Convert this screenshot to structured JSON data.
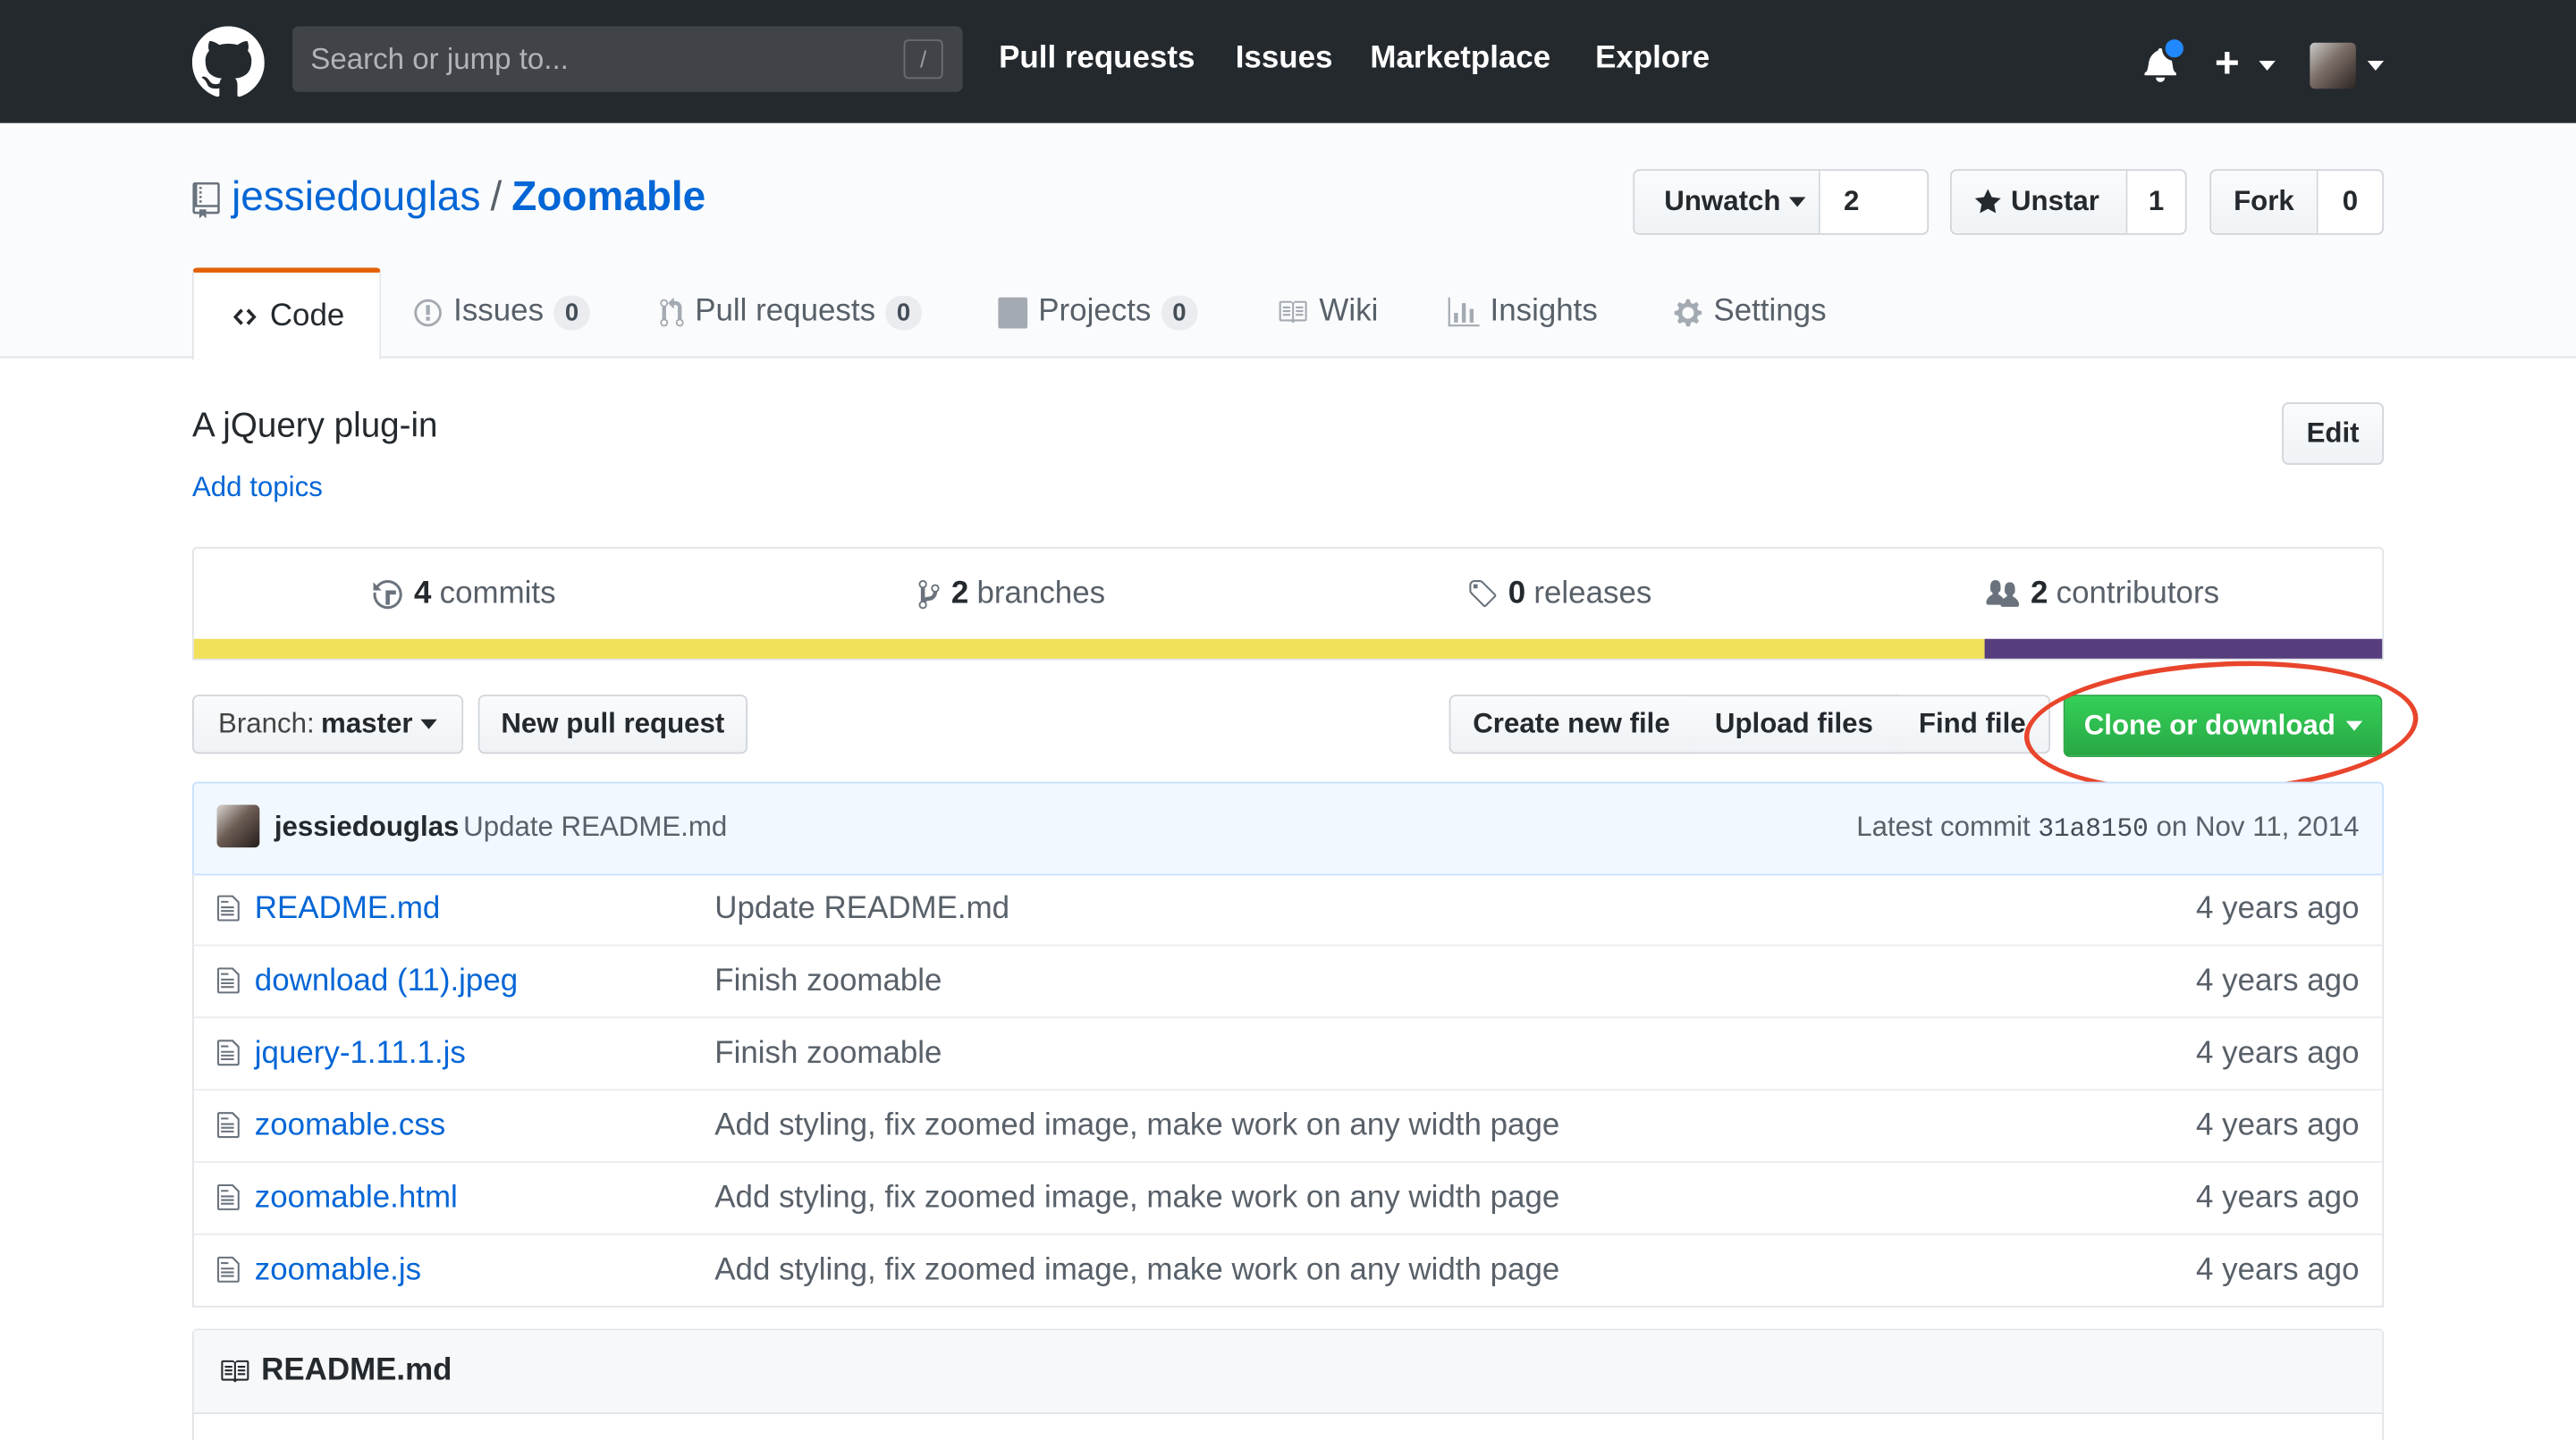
{
  "header": {
    "search_placeholder": "Search or jump to...",
    "search_shortcut": "/",
    "nav": [
      "Pull requests",
      "Issues",
      "Marketplace",
      "Explore"
    ],
    "icons": [
      "github-logo-icon",
      "bell-icon",
      "plus-icon",
      "avatar"
    ]
  },
  "repo": {
    "owner": "jessiedouglas",
    "separator": "/",
    "name": "Zoomable",
    "unwatch_label": "Unwatch",
    "watch_count": "2",
    "unstar_label": "Unstar",
    "star_count": "1",
    "fork_label": "Fork",
    "fork_count": "0"
  },
  "tabs": [
    {
      "label": "Code"
    },
    {
      "label": "Issues",
      "count": "0"
    },
    {
      "label": "Pull requests",
      "count": "0"
    },
    {
      "label": "Projects",
      "count": "0"
    },
    {
      "label": "Wiki"
    },
    {
      "label": "Insights"
    },
    {
      "label": "Settings"
    }
  ],
  "description": "A jQuery plug-in",
  "add_topics": "Add topics",
  "edit_label": "Edit",
  "summary": {
    "commits_num": "4",
    "commits_label": "commits",
    "branches_num": "2",
    "branches_label": "branches",
    "releases_num": "0",
    "releases_label": "releases",
    "contributors_num": "2",
    "contributors_label": "contributors"
  },
  "language_bar": [
    {
      "color": "#f1e05a",
      "fraction": 0.818
    },
    {
      "color": "#563d7c",
      "fraction": 0.182
    }
  ],
  "file_nav": {
    "branch_prefix": "Branch:",
    "branch": "master",
    "new_pr": "New pull request",
    "create_file": "Create new file",
    "upload": "Upload files",
    "find_file": "Find file",
    "clone": "Clone or download",
    "highlight_color": "#e8452c"
  },
  "commit": {
    "author": "jessiedouglas",
    "message": "Update README.md",
    "latest_prefix": "Latest commit",
    "sha": "31a8150",
    "date_prefix": "on",
    "date": "Nov 11, 2014"
  },
  "files": [
    {
      "name": "README.md",
      "message": "Update README.md",
      "age": "4 years ago"
    },
    {
      "name": "download (11).jpeg",
      "message": "Finish zoomable",
      "age": "4 years ago"
    },
    {
      "name": "jquery-1.11.1.js",
      "message": "Finish zoomable",
      "age": "4 years ago"
    },
    {
      "name": "zoomable.css",
      "message": "Add styling, fix zoomed image, make work on any width page",
      "age": "4 years ago"
    },
    {
      "name": "zoomable.html",
      "message": "Add styling, fix zoomed image, make work on any width page",
      "age": "4 years ago"
    },
    {
      "name": "zoomable.js",
      "message": "Add styling, fix zoomed image, make work on any width page",
      "age": "4 years ago"
    }
  ],
  "readme_title": "README.md"
}
